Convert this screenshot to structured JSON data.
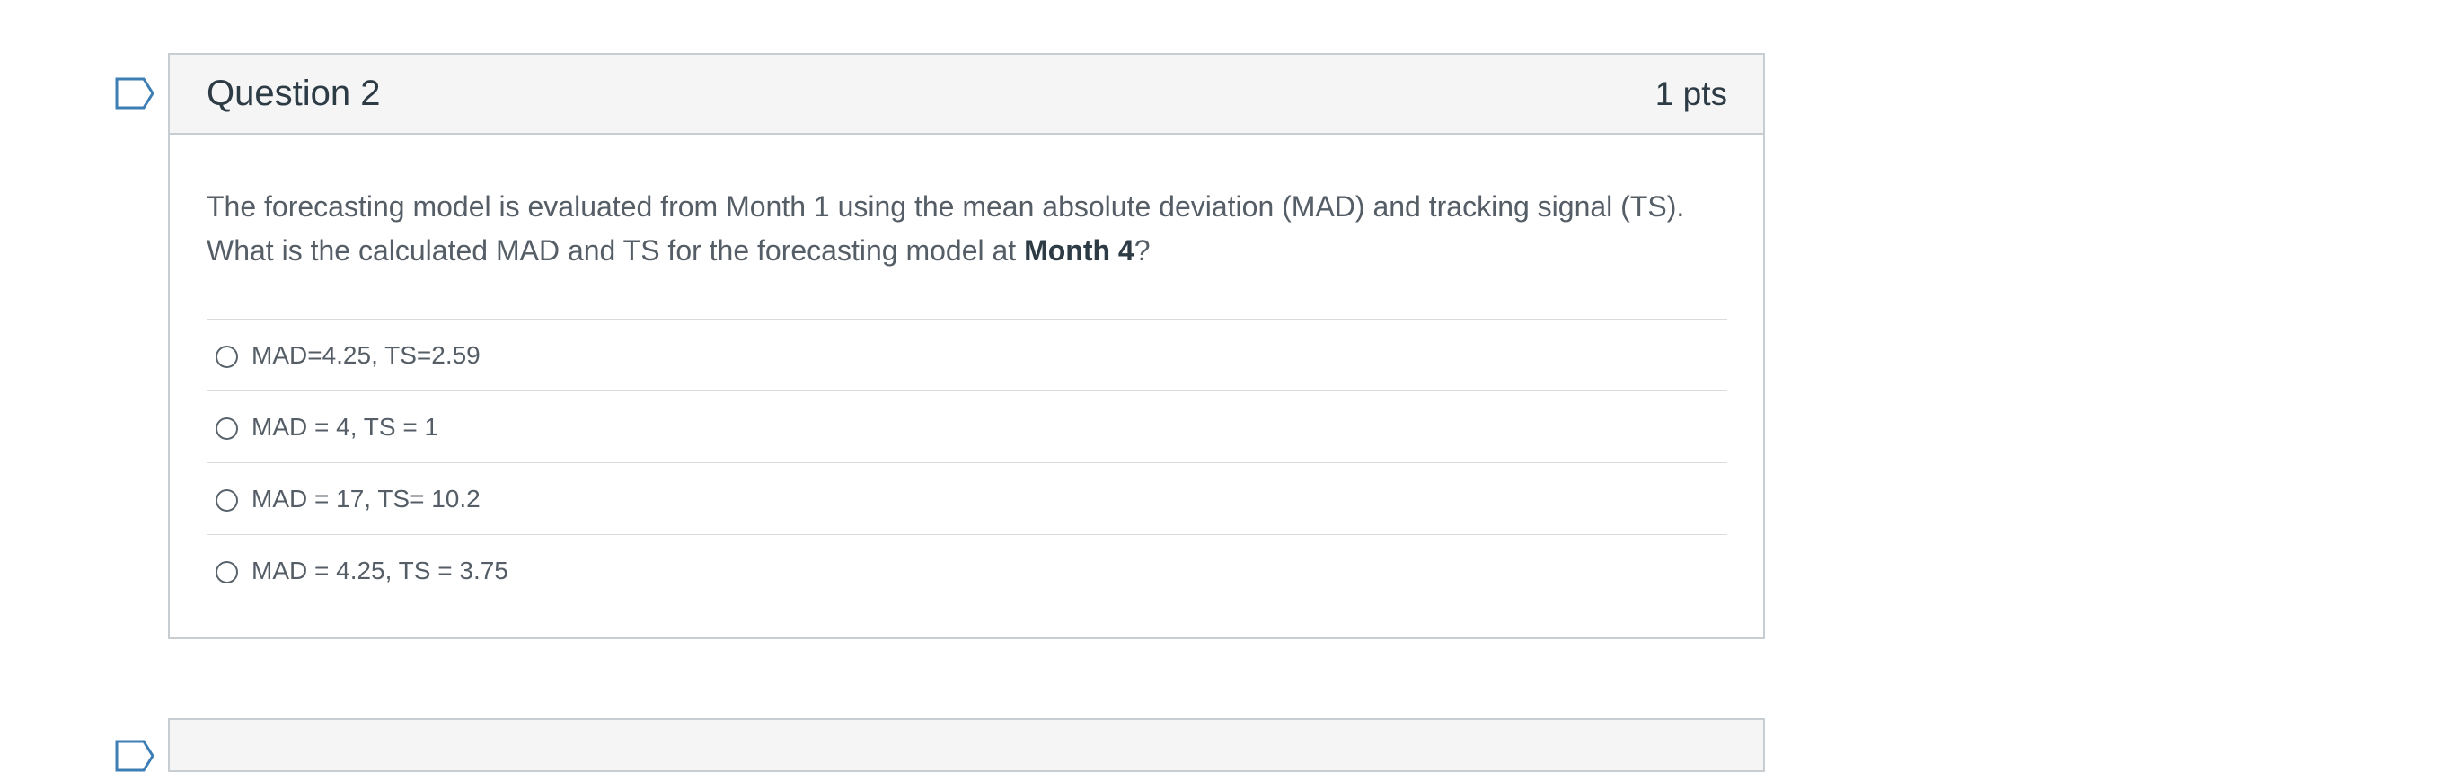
{
  "question": {
    "title": "Question 2",
    "points": "1 pts",
    "text_before": "The forecasting model is evaluated from Month 1 using the mean absolute deviation (MAD) and tracking signal (TS). What is the calculated MAD and TS for the forecasting model at ",
    "text_bold": "Month 4",
    "text_after": "?",
    "answers": [
      {
        "label": "MAD=4.25, TS=2.59"
      },
      {
        "label": "MAD = 4, TS = 1"
      },
      {
        "label": "MAD = 17, TS= 10.2"
      },
      {
        "label": "MAD = 4.25, TS = 3.75"
      }
    ]
  },
  "icons": {
    "flag": "flag-outline-icon"
  },
  "colors": {
    "header_bg": "#f5f5f5",
    "border": "#c7cdd1",
    "text": "#2D3B45",
    "flag_stroke": "#3d7eb5"
  }
}
